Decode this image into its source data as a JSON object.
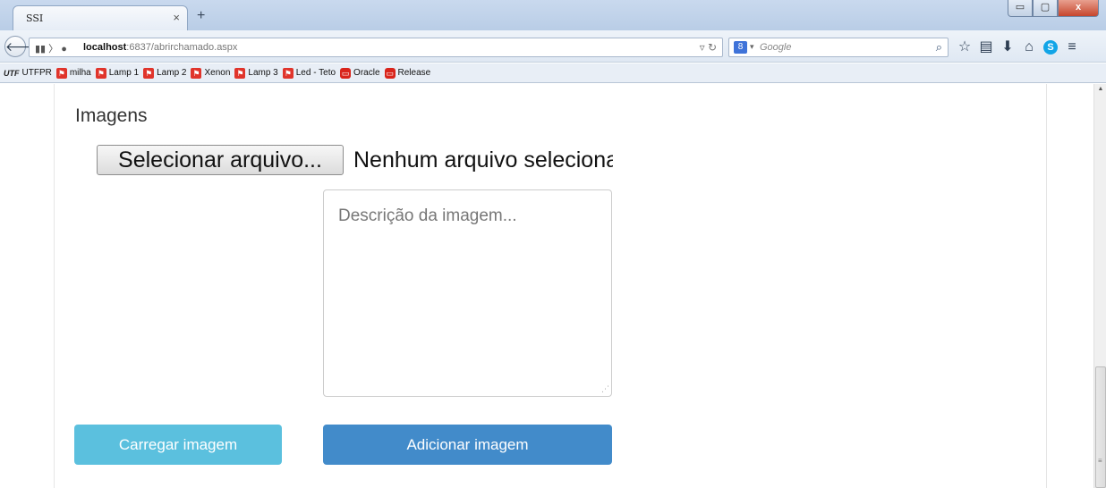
{
  "browser": {
    "tab_title": "SSI",
    "tab_close": "×",
    "new_tab": "+",
    "window_buttons": {
      "minimize": "▭",
      "maximize": "▢",
      "close": "x"
    },
    "url_host": "localhost",
    "url_rest": ":6837/abrirchamado.aspx",
    "search_engine_badge": "8",
    "search_placeholder": "Google",
    "icons": [
      "back-icon",
      "page-icon",
      "globe-icon",
      "dropdown-icon",
      "reload-icon",
      "search-icon",
      "star-icon",
      "reading-list-icon",
      "download-icon",
      "home-icon",
      "skype-icon",
      "menu-icon"
    ]
  },
  "bookmarks": [
    {
      "label": "UTFPR",
      "icon": "UTF"
    },
    {
      "label": "milha",
      "icon": "bookmark-icon"
    },
    {
      "label": "Lamp 1",
      "icon": "bookmark-icon"
    },
    {
      "label": "Lamp 2",
      "icon": "bookmark-icon"
    },
    {
      "label": "Xenon",
      "icon": "bookmark-icon"
    },
    {
      "label": "Lamp 3",
      "icon": "bookmark-icon"
    },
    {
      "label": "Led - Teto",
      "icon": "bookmark-icon"
    },
    {
      "label": "Oracle",
      "icon": "oracle-icon"
    },
    {
      "label": "Release",
      "icon": "oracle-icon"
    }
  ],
  "page": {
    "section_title": "Imagens",
    "file_button": "Selecionar arquivo...",
    "file_status": "Nenhum arquivo selecionado.",
    "description_placeholder": "Descrição da imagem...",
    "load_button": "Carregar imagem",
    "add_button": "Adicionar imagem"
  },
  "colors": {
    "load_button": "#5bc0de",
    "add_button": "#428bca",
    "window_close": "#c6452c"
  }
}
